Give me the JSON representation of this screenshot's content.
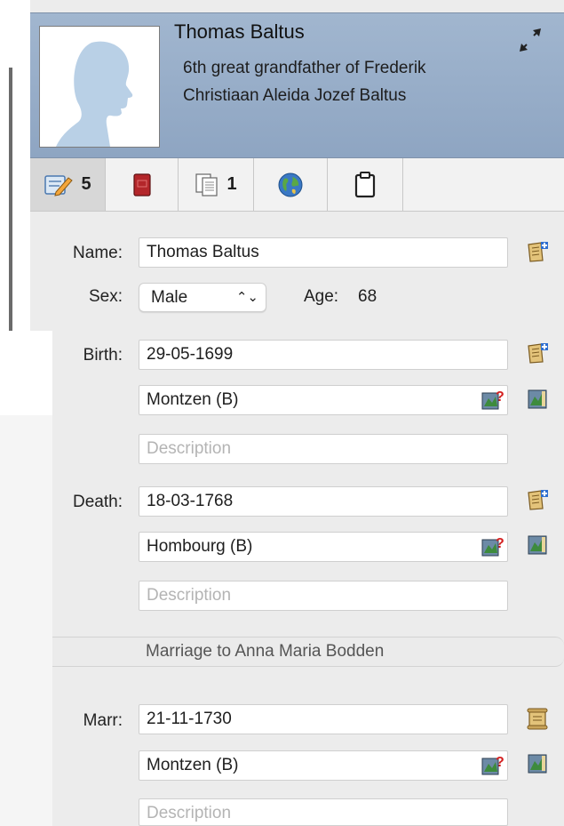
{
  "header": {
    "name": "Thomas Baltus",
    "relation_line1": "6th great grandfather of Frederik",
    "relation_line2": "Christiaan Aleida Jozef Baltus",
    "expand_icon": "expand-arrows-icon"
  },
  "tabs": [
    {
      "icon": "edit-notes-icon",
      "count": "5"
    },
    {
      "icon": "book-icon",
      "count": ""
    },
    {
      "icon": "documents-icon",
      "count": "1"
    },
    {
      "icon": "globe-icon",
      "count": ""
    },
    {
      "icon": "clipboard-icon",
      "count": ""
    }
  ],
  "form": {
    "name_label": "Name:",
    "name_value": "Thomas Baltus",
    "sex_label": "Sex:",
    "sex_value": "Male",
    "age_label": "Age:",
    "age_value": "68",
    "birth_label": "Birth:",
    "birth_date": "29-05-1699",
    "birth_place": "Montzen (B)",
    "birth_description_placeholder": "Description",
    "death_label": "Death:",
    "death_date": "18-03-1768",
    "death_place": "Hombourg (B)",
    "death_description_placeholder": "Description",
    "marriage_title": "Marriage to Anna Maria Bodden",
    "marr_label": "Marr:",
    "marr_date": "21-11-1730",
    "marr_place": "Montzen (B)",
    "marr_description_placeholder": "Description"
  },
  "colors": {
    "header_bg": "#96abc7",
    "silhouette": "#b5cde4",
    "active_tab": "#d7d7d7"
  }
}
